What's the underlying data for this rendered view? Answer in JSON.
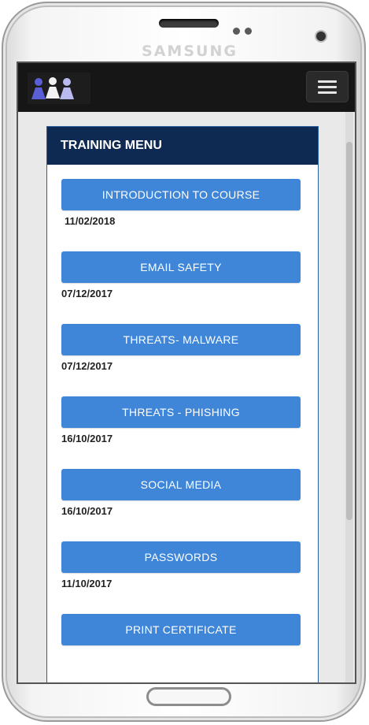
{
  "device": {
    "brand": "SAMSUNG"
  },
  "app": {
    "logo_icon": "people-logo-icon",
    "menu_icon": "hamburger-menu-icon"
  },
  "panel": {
    "title": "TRAINING MENU",
    "courses": [
      {
        "label": "INTRODUCTION TO COURSE",
        "date": "11/02/2018"
      },
      {
        "label": "EMAIL SAFETY",
        "date": "07/12/2017"
      },
      {
        "label": "THREATS- MALWARE",
        "date": "07/12/2017"
      },
      {
        "label": "THREATS - PHISHING",
        "date": "16/10/2017"
      },
      {
        "label": "SOCIAL MEDIA",
        "date": "16/10/2017"
      },
      {
        "label": "PASSWORDS",
        "date": "11/10/2017"
      }
    ],
    "certificate_label": "PRINT CERTIFICATE"
  },
  "colors": {
    "header_bar": "#161616",
    "panel_header": "#0e2a52",
    "button": "#3f86d8"
  }
}
